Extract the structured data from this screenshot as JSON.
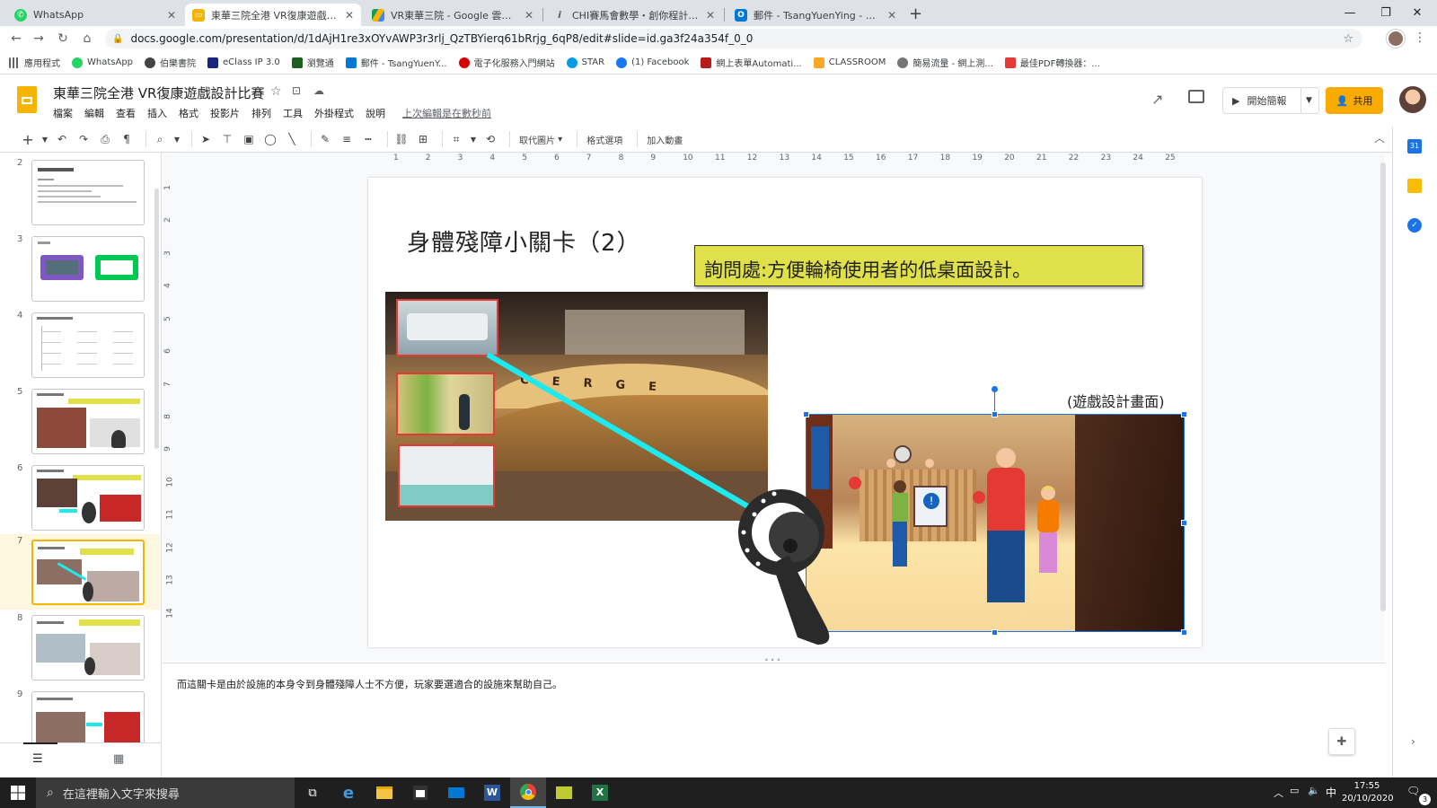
{
  "tabs": [
    {
      "title": "WhatsApp",
      "icon": "whatsapp-icon",
      "color": "#25d366"
    },
    {
      "title": "東華三院全港 VR復康遊戲設計比",
      "icon": "google-slides-icon",
      "color": "#f4b400",
      "active": true
    },
    {
      "title": "VR東華三院 - Google 雲端硬碟",
      "icon": "google-drive-icon",
      "color": "#0f9d58"
    },
    {
      "title": "CHI賽馬會數學・創你程計劃研討",
      "icon": "info-icon",
      "color": "#5f6368"
    },
    {
      "title": "郵件 - TsangYuenYing - Outloo",
      "icon": "outlook-icon",
      "color": "#0078d4"
    }
  ],
  "address": {
    "url": "docs.google.com/presentation/d/1dAjH1re3xOYvAWP3r3rlj_QzTBYierq61bRrjg_6qP8/edit#slide=id.ga3f24a354f_0_0"
  },
  "bookmarks": [
    {
      "label": "應用程式",
      "color": "#5f6368"
    },
    {
      "label": "WhatsApp",
      "color": "#25d366"
    },
    {
      "label": "伯樂書院",
      "color": "#444"
    },
    {
      "label": "eClass IP 3.0",
      "color": "#1a237e"
    },
    {
      "label": "瀏覽通",
      "color": "#1b5e20"
    },
    {
      "label": "郵件 - TsangYuenY...",
      "color": "#0078d4"
    },
    {
      "label": "電子化服務入門網站",
      "color": "#d50000"
    },
    {
      "label": "STAR",
      "color": "#039be5"
    },
    {
      "label": "(1) Facebook",
      "color": "#1877f2"
    },
    {
      "label": "網上表單Automati...",
      "color": "#b71c1c"
    },
    {
      "label": "CLASSROOM",
      "color": "#f9a825"
    },
    {
      "label": "簡易流量 - 網上測...",
      "color": "#757575"
    },
    {
      "label": "最佳PDF轉換器：...",
      "color": "#e53935"
    }
  ],
  "doc": {
    "title": "東華三院全港 VR復康遊戲設計比賽",
    "menu": [
      "檔案",
      "編輯",
      "查看",
      "插入",
      "格式",
      "投影片",
      "排列",
      "工具",
      "外掛程式",
      "說明"
    ],
    "last_edit": "上次編輯是在數秒前",
    "present_label": "開始簡報",
    "share_label": "共用"
  },
  "toolbar": {
    "replace_image": "取代圖片",
    "format_options": "格式選項",
    "animate": "加入動畫"
  },
  "ruler": {
    "h_ticks": [
      "1",
      "2",
      "3",
      "4",
      "5",
      "6",
      "7",
      "8",
      "9",
      "10",
      "11",
      "12",
      "13",
      "14",
      "15",
      "16",
      "17",
      "18",
      "19",
      "20",
      "21",
      "22",
      "23",
      "24",
      "25"
    ],
    "v_ticks": [
      "1",
      "2",
      "3",
      "4",
      "5",
      "6",
      "7",
      "8",
      "9",
      "10",
      "11",
      "12",
      "13",
      "14"
    ]
  },
  "slides": [
    {
      "num": "2"
    },
    {
      "num": "3"
    },
    {
      "num": "4"
    },
    {
      "num": "5"
    },
    {
      "num": "6"
    },
    {
      "num": "7",
      "selected": true
    },
    {
      "num": "8"
    },
    {
      "num": "9"
    }
  ],
  "slide": {
    "title": "身體殘障小關卡（2）",
    "callout": "詢問處:方便輪椅使用者的低桌面設計。",
    "caption": "(遊戲設計畫面)",
    "concierge_letters": [
      "C",
      "E",
      "R",
      "G",
      "E"
    ],
    "colors": {
      "callout_bg": "#dfe04a",
      "beam": "#1de9f0",
      "red_box": "#e53935",
      "selection": "#1a73e8"
    }
  },
  "notes": {
    "text": "而這關卡是由於設施的本身令到身體殘障人士不方便，玩家要選適合的設施來幫助自己。"
  },
  "taskbar": {
    "search_placeholder": "在這裡輸入文字來搜尋",
    "ime": "中",
    "time": "17:55",
    "date": "20/10/2020",
    "notif_count": "3"
  }
}
